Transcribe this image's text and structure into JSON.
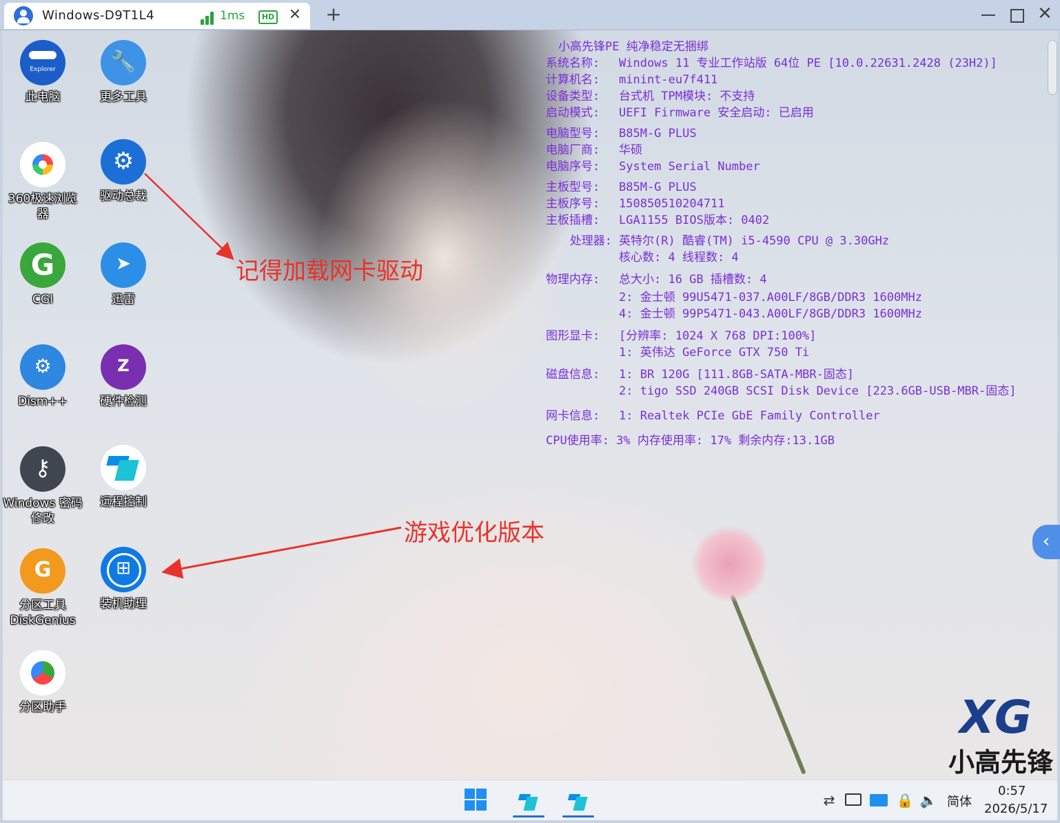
{
  "window": {
    "tab_title": "Windows-D9T1L4",
    "latency": "1ms",
    "quality_badge": "HD",
    "close_glyph": "✕",
    "new_tab_glyph": "+",
    "close_window_glyph": "✕"
  },
  "desktop_icons": [
    {
      "label": "此电脑",
      "icon": "explorer-icon",
      "badge": "Explorer"
    },
    {
      "label": "更多工具",
      "icon": "wrench-icon"
    },
    {
      "label": "360极速浏览器",
      "icon": "browser-360-icon"
    },
    {
      "label": "驱动总裁",
      "icon": "driver-gear-icon"
    },
    {
      "label": "CGI",
      "icon": "cgi-icon",
      "glyph": "G"
    },
    {
      "label": "迅雷",
      "icon": "xunlei-icon"
    },
    {
      "label": "Dism++",
      "icon": "dism-icon"
    },
    {
      "label": "硬件检测",
      "icon": "hardware-check-icon",
      "glyph": "Z"
    },
    {
      "label": "Windows 密码修改",
      "icon": "key-icon"
    },
    {
      "label": "远程控制",
      "icon": "remote-control-icon"
    },
    {
      "label": "分区工具DiskGenius",
      "icon": "diskgenius-icon",
      "glyph": "G"
    },
    {
      "label": "装机助理",
      "icon": "windows-setup-icon"
    },
    {
      "label": "分区助手",
      "icon": "partition-assistant-icon"
    }
  ],
  "sysinfo": {
    "rows": [
      {
        "key": "",
        "value": "小高先锋PE 纯净稳定无捆绑"
      },
      {
        "key": "系统名称:",
        "value": "Windows 11 专业工作站版 64位 PE [10.0.22631.2428 (23H2)]"
      },
      {
        "key": "计算机名:",
        "value": "minint-eu7f411"
      },
      {
        "key": "设备类型:",
        "value": "台式机 TPM模块: 不支持"
      },
      {
        "key": "启动模式:",
        "value": "UEFI Firmware  安全启动: 已启用"
      },
      {
        "key": "电脑型号:",
        "value": "B85M-G PLUS"
      },
      {
        "key": "电脑厂商:",
        "value": "华硕"
      },
      {
        "key": "电脑序号:",
        "value": "System Serial Number"
      },
      {
        "key": "主板型号:",
        "value": "B85M-G PLUS"
      },
      {
        "key": "主板序号:",
        "value": "150850510204711"
      },
      {
        "key": "主板插槽:",
        "value": "LGA1155  BIOS版本: 0402"
      },
      {
        "key": "处理器:",
        "value": "英特尔(R) 酷睿(TM) i5-4590 CPU @ 3.30GHz"
      },
      {
        "key": "",
        "value": "核心数: 4  线程数: 4"
      },
      {
        "key": "物理内存:",
        "value": "总大小: 16 GB 插槽数: 4"
      },
      {
        "key": "",
        "value": "2: 金士顿 99U5471-037.A00LF/8GB/DDR3 1600MHz"
      },
      {
        "key": "",
        "value": "4: 金士顿 99P5471-043.A00LF/8GB/DDR3 1600MHz"
      },
      {
        "key": "图形显卡:",
        "value": "[分辨率: 1024 X 768 DPI:100%]"
      },
      {
        "key": "",
        "value": "1: 英伟达 GeForce GTX 750 Ti"
      },
      {
        "key": "磁盘信息:",
        "value": "1: BR 120G [111.8GB-SATA-MBR-固态]"
      },
      {
        "key": "",
        "value": "2: tigo SSD  240GB SCSI Disk Device [223.6GB-USB-MBR-固态]"
      },
      {
        "key": "网卡信息:",
        "value": "1: Realtek PCIe GbE Family Controller"
      },
      {
        "key": "",
        "value": "CPU使用率: 3% 内存使用率: 17% 剩余内存:13.1GB"
      }
    ]
  },
  "annotations": {
    "driver_note": "记得加载网卡驱动",
    "setup_note": "游戏优化版本"
  },
  "brand": {
    "logo_text": "XG",
    "name": "小高先锋"
  },
  "taskbar": {
    "ime": "简体",
    "time": "0:57",
    "date": "2026/5/17",
    "volume_glyph": "🔈"
  },
  "colors": {
    "sysinfo_text": "#7a2fd6",
    "annotation": "#e8332a",
    "accent": "#1f8ff0"
  }
}
